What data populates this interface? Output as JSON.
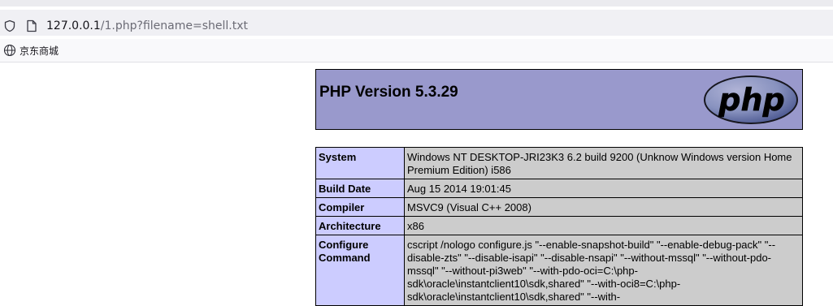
{
  "browser": {
    "url_host": "127.0.0.1",
    "url_rest": "/1.php?filename=shell.txt",
    "bookmark_label": "京东商城"
  },
  "php": {
    "title": "PHP Version 5.3.29",
    "logo_text": "php",
    "rows": [
      {
        "key": "System",
        "value": "Windows NT DESKTOP-JRI23K3 6.2 build 9200 (Unknow Windows version Home Premium Edition) i586"
      },
      {
        "key": "Build Date",
        "value": "Aug 15 2014 19:01:45"
      },
      {
        "key": "Compiler",
        "value": "MSVC9 (Visual C++ 2008)"
      },
      {
        "key": "Architecture",
        "value": "x86"
      },
      {
        "key": "Configure Command",
        "value": "cscript /nologo configure.js \"--enable-snapshot-build\" \"--enable-debug-pack\" \"--disable-zts\" \"--disable-isapi\" \"--disable-nsapi\" \"--without-mssql\" \"--without-pdo-mssql\" \"--without-pi3web\" \"--with-pdo-oci=C:\\php-sdk\\oracle\\instantclient10\\sdk,shared\" \"--with-oci8=C:\\php-sdk\\oracle\\instantclient10\\sdk,shared\" \"--with-"
      }
    ]
  }
}
